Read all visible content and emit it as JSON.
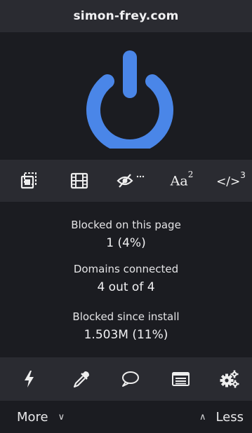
{
  "header": {
    "domain": "simon-frey.com"
  },
  "power": {
    "icon": "power-icon",
    "color": "#4a86e8"
  },
  "toolbar": {
    "items": [
      {
        "icon": "popup-blocker-icon"
      },
      {
        "icon": "media-film-icon"
      },
      {
        "icon": "cosmetic-filter-eye-icon"
      },
      {
        "icon": "remote-fonts-icon",
        "label": "Aa",
        "sup": "2"
      },
      {
        "icon": "javascript-code-icon",
        "label": "</>",
        "sup": "3"
      }
    ]
  },
  "stats": {
    "blocked_page_label": "Blocked on this page",
    "blocked_page_value": "1 (4%)",
    "domains_label": "Domains connected",
    "domains_value": "4 out of 4",
    "blocked_install_label": "Blocked since install",
    "blocked_install_value": "1.503M (11%)"
  },
  "bottombar": {
    "items": [
      {
        "icon": "lightning-icon"
      },
      {
        "icon": "eyedropper-icon"
      },
      {
        "icon": "speech-bubble-icon"
      },
      {
        "icon": "logger-list-icon"
      },
      {
        "icon": "settings-gears-icon"
      }
    ]
  },
  "footer": {
    "more_label": "More",
    "less_label": "Less"
  },
  "colors": {
    "accent": "#4a86e8",
    "bar_bg": "#2a2b31",
    "panel_bg": "#1b1c21"
  }
}
